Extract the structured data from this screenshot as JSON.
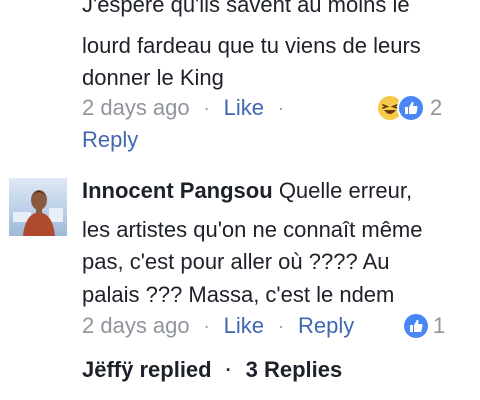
{
  "comment1": {
    "lines": [
      "J'espère qu'ils savent au moins le",
      "lourd fardeau que tu viens de leurs",
      "donner le King"
    ],
    "time": "2 days ago",
    "separator": "·",
    "like_label": "Like",
    "reaction_count": "2",
    "reply_label": "Reply"
  },
  "comment2": {
    "author": "Innocent Pangsou",
    "text_first": "Quelle erreur,",
    "lines": [
      "les artistes qu'on ne connaît même",
      "pas, c'est pour aller où ????  Au",
      "palais ???  Massa, c'est le ndem"
    ],
    "time": "2 days ago",
    "separator": "·",
    "like_label": "Like",
    "reply_label": "Reply",
    "reaction_count": "1"
  },
  "replies": {
    "author": "Jëffÿ replied",
    "separator": "·",
    "count_label": "3 Replies"
  },
  "icons": {
    "like": "like-thumb-icon",
    "haha": "haha-laugh-icon"
  },
  "colors": {
    "text": "#1d2129",
    "meta_grey": "#90949c",
    "link_blue": "#4267b2",
    "like_icon": "#4a86f5",
    "haha_icon": "#f7c948"
  }
}
